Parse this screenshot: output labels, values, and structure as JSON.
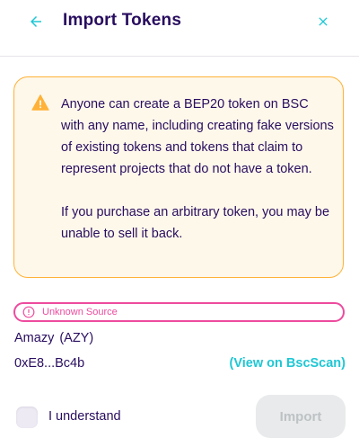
{
  "header": {
    "title": "Import Tokens",
    "back_icon": "arrow-left-icon",
    "close_icon": "close-icon"
  },
  "warning": {
    "icon": "warning-triangle-icon",
    "paragraph1": "Anyone can create a BEP20 token on BSC with any name, including creating fake versions of existing tokens and tokens that claim to represent projects that do not have a token.",
    "paragraph2": "If you purchase an arbitrary token, you may be unable to sell it back."
  },
  "badge": {
    "icon": "alert-circle-icon",
    "label": "Unknown Source"
  },
  "token": {
    "name": "Amazy",
    "symbol": "(AZY)",
    "address": "0xE8...Bc4b",
    "link_label": "(View on BscScan)"
  },
  "footer": {
    "checkbox_label": "I understand",
    "checkbox_checked": false,
    "import_label": "Import"
  },
  "colors": {
    "primary_text": "#280d5f",
    "accent": "#1fc7d4",
    "warning": "#ffb237",
    "failure": "#ed4b9e",
    "disabled_bg": "#e9eaeb"
  }
}
